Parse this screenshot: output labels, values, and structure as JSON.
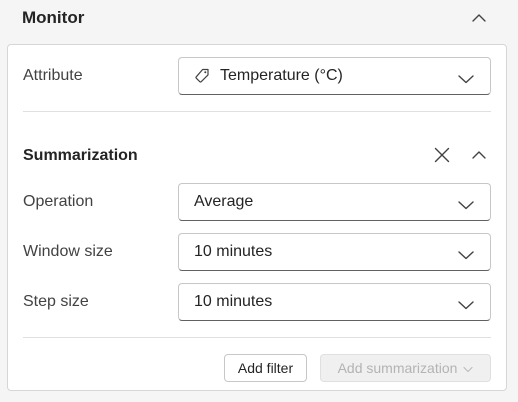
{
  "header": {
    "title": "Monitor",
    "collapse_icon": "chevron-up-icon"
  },
  "attribute": {
    "label": "Attribute",
    "value": "Temperature (°C)",
    "value_icon": "tag-icon",
    "dropdown_icon": "chevron-down-icon"
  },
  "summarization": {
    "title": "Summarization",
    "close_icon": "close-icon",
    "collapse_icon": "chevron-up-icon",
    "fields": [
      {
        "label": "Operation",
        "value": "Average"
      },
      {
        "label": "Window size",
        "value": "10 minutes"
      },
      {
        "label": "Step size",
        "value": "10 minutes"
      }
    ]
  },
  "actions": {
    "add_filter": "Add filter",
    "add_summarization": "Add summarization",
    "add_summarization_disabled": true
  }
}
